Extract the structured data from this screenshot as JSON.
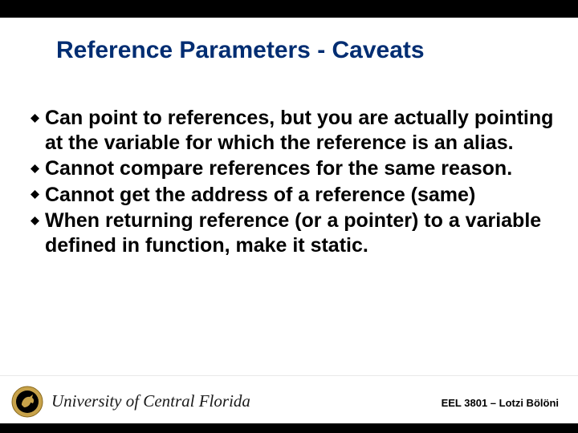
{
  "title": "Reference Parameters - Caveats",
  "bullets": [
    "Can point to references, but you are actually pointing at the variable for which the reference is an alias.",
    "Cannot compare references for the same reason.",
    "Cannot get the address of a reference (same)",
    "When returning reference (or a pointer) to a variable defined in function, make it static."
  ],
  "footer": {
    "university": "University of Central Florida",
    "course": "EEL 3801 – Lotzi Bölöni"
  },
  "colors": {
    "title": "#002d72",
    "accent_gold": "#c7a24a",
    "black": "#000000"
  }
}
